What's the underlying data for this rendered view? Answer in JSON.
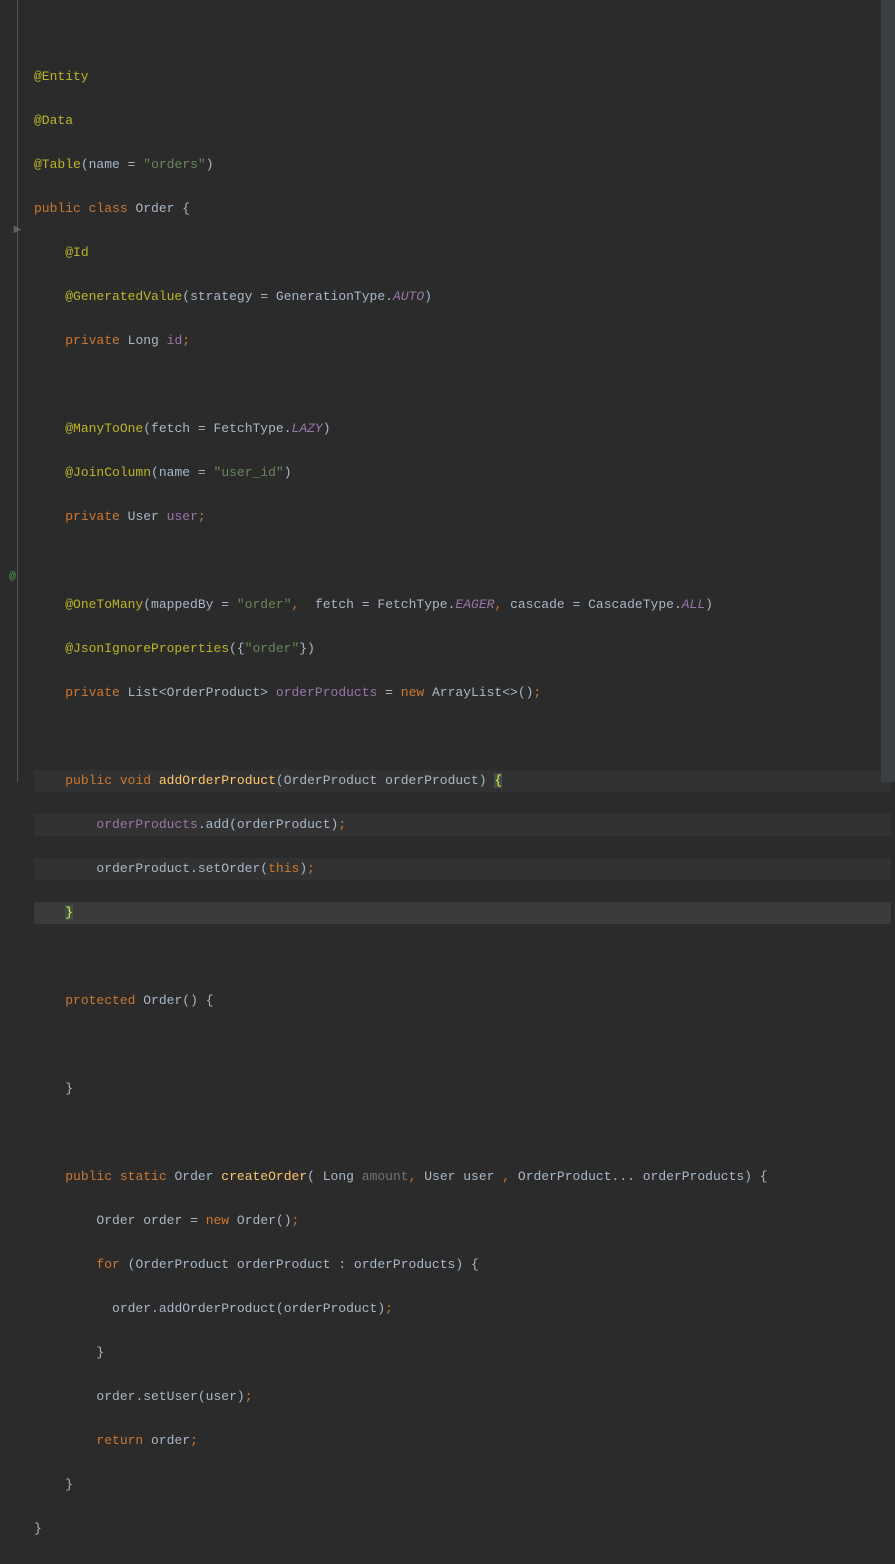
{
  "code": {
    "entity": "@Entity",
    "data": "@Data",
    "table_ann": "@Table",
    "table_name_key": "name",
    "table_name_val": "\"orders\"",
    "public": "public",
    "class": "class",
    "order": "Order",
    "id_ann": "@Id",
    "gen_ann": "@GeneratedValue",
    "strategy": "strategy",
    "gentype": "GenerationType",
    "auto": "AUTO",
    "private": "private",
    "long": "Long",
    "id_field": "id",
    "many": "@ManyToOne",
    "fetch": "fetch",
    "fetchtype": "FetchType",
    "lazy": "LAZY",
    "joincol": "@JoinColumn",
    "name": "name",
    "user_id": "\"user_id\"",
    "user_type": "User",
    "user_field": "user",
    "onetomany": "@OneToMany",
    "mappedby": "mappedBy",
    "order_str": "\"order\"",
    "eager": "EAGER",
    "cascade": "cascade",
    "cascadetype": "CascadeType",
    "all": "ALL",
    "jsonignore": "@JsonIgnoreProperties",
    "list": "List",
    "orderproduct": "OrderProduct",
    "orderproducts_field": "orderProducts",
    "new": "new",
    "arraylist": "ArrayList<>",
    "void": "void",
    "addop": "addOrderProduct",
    "op_param": "orderProduct",
    "add": "add",
    "setorder": "setOrder",
    "this": "this",
    "protected": "protected",
    "static": "static",
    "createorder": "createOrder",
    "amount": "amount",
    "vararg": "OrderProduct...",
    "orderproducts_param": "orderProducts",
    "local_order": "order",
    "for": "for",
    "addop_call": "addOrderProduct",
    "setuser": "setUser",
    "return": "return"
  }
}
